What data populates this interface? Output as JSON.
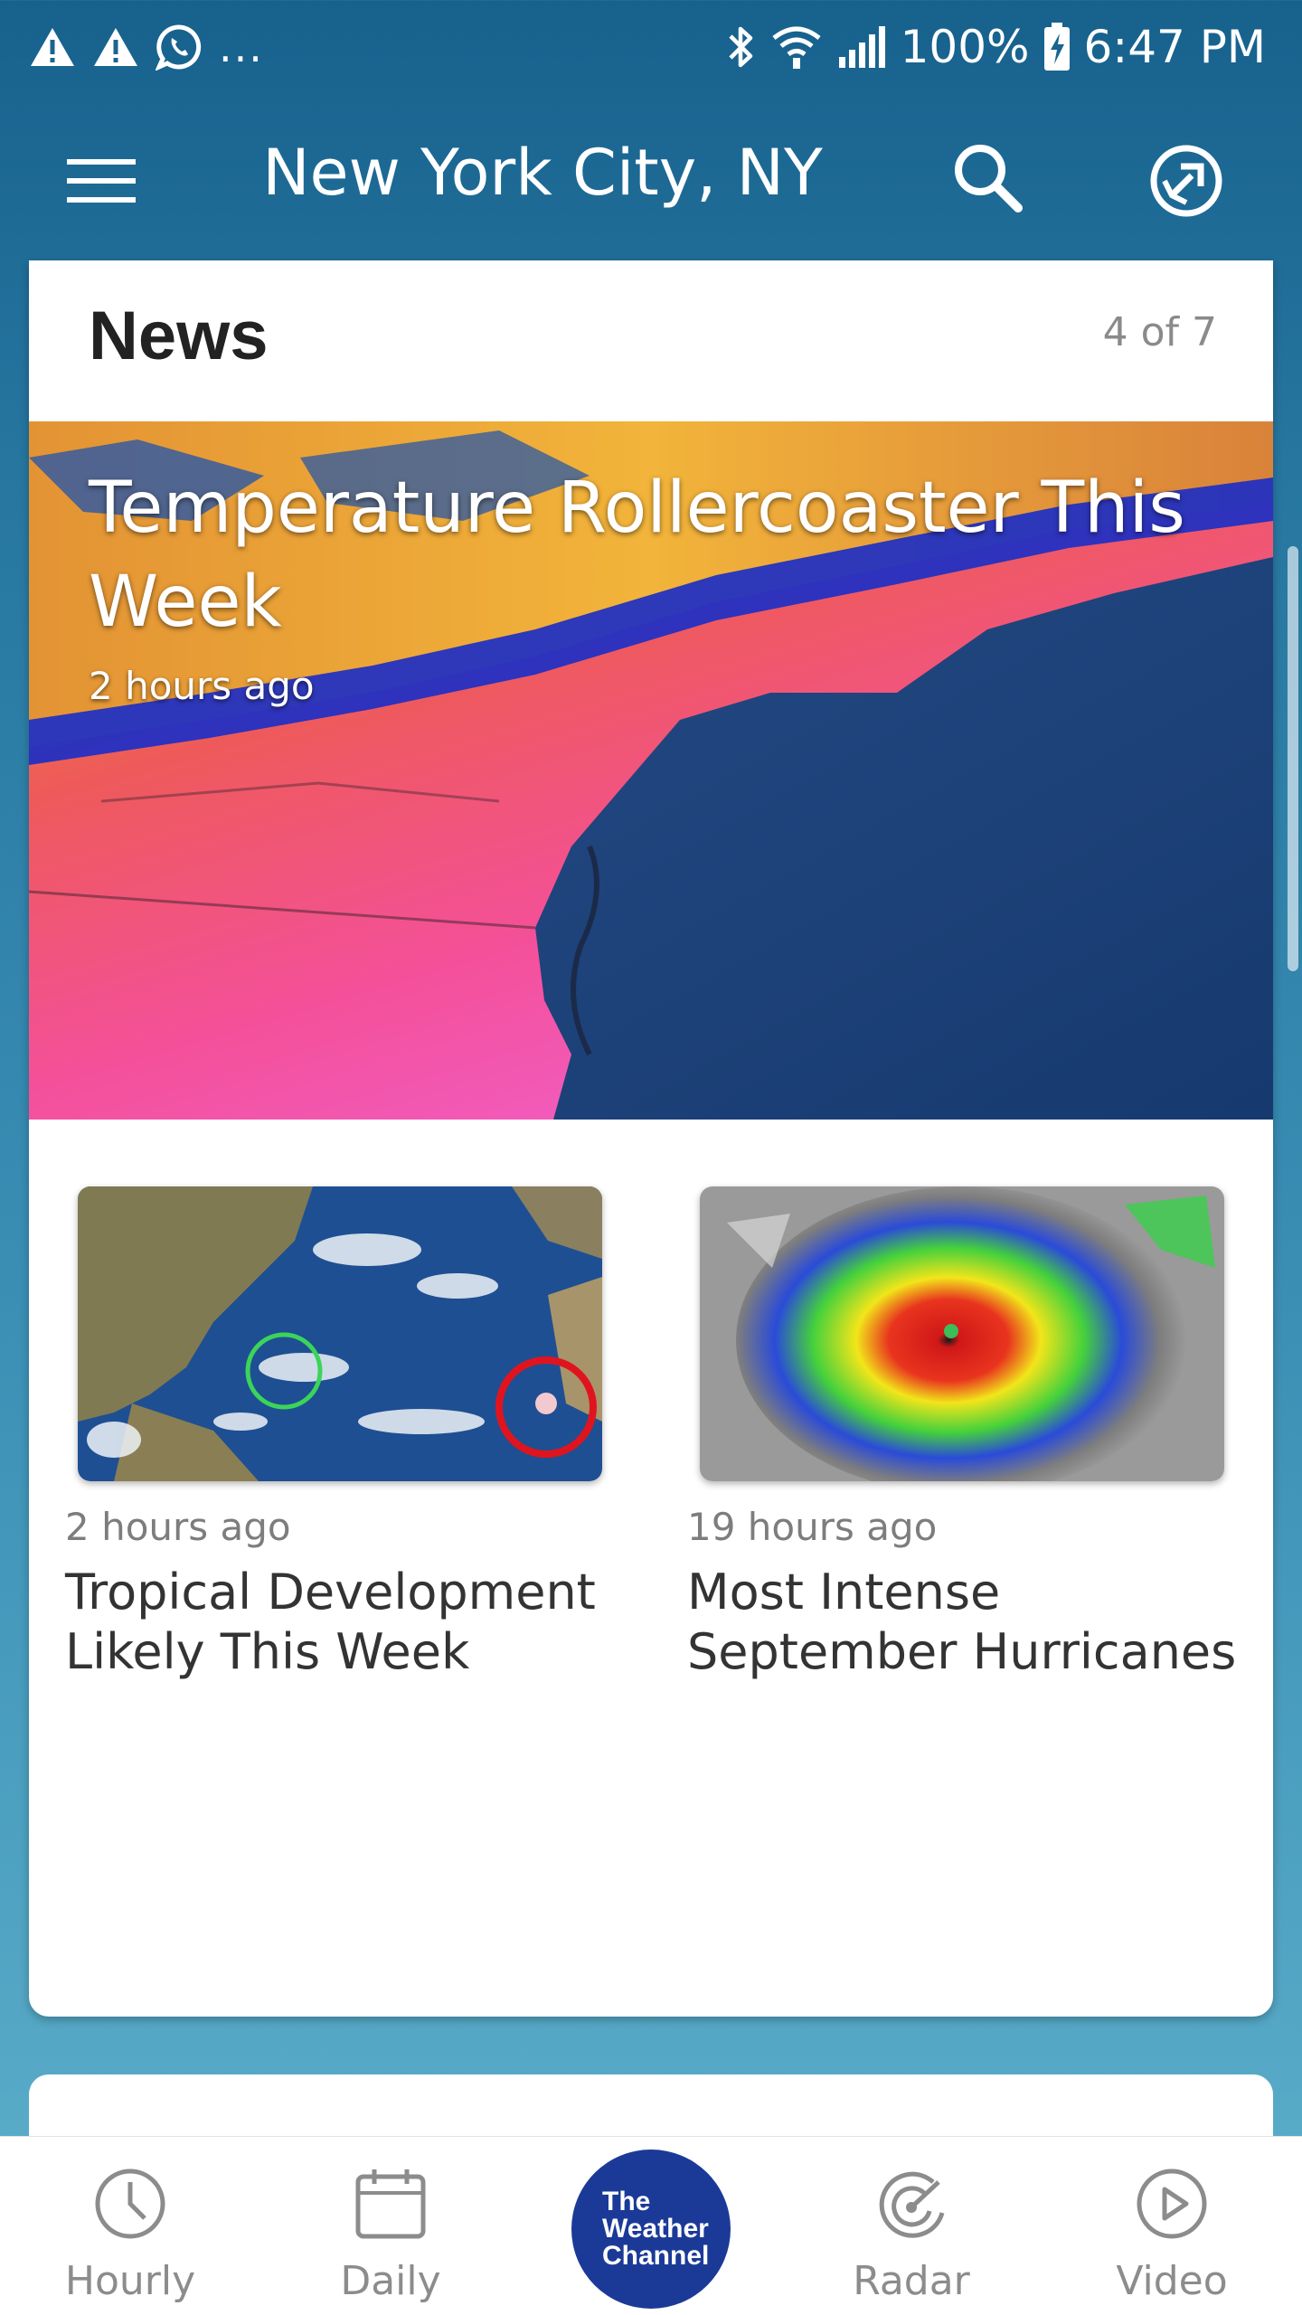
{
  "status_bar": {
    "battery": "100%",
    "time": "6:47 PM",
    "overflow": "...",
    "icons_left": [
      "warning-icon",
      "warning-icon",
      "whatsapp-icon"
    ],
    "icons_right": [
      "bluetooth-icon",
      "wifi-icon",
      "signal-icon",
      "battery-charging-icon"
    ]
  },
  "app_bar": {
    "location": "New York City, NY",
    "icons": [
      "menu-icon",
      "search-icon",
      "locate-icon"
    ]
  },
  "news": {
    "heading": "News",
    "counter": "4 of 7",
    "hero": {
      "title": "Temperature Rollercoaster This Week",
      "time": "2 hours ago"
    },
    "stories": [
      {
        "time": "2 hours ago",
        "title": "Tropical Development Likely This Week"
      },
      {
        "time": "19 hours ago",
        "title": "Most Intense September Hurricanes"
      }
    ]
  },
  "bottom_nav": {
    "items": [
      {
        "label": "Hourly",
        "icon": "clock-icon"
      },
      {
        "label": "Daily",
        "icon": "calendar-icon"
      },
      {
        "label": "Radar",
        "icon": "radar-icon"
      },
      {
        "label": "Video",
        "icon": "play-icon"
      }
    ],
    "logo_lines": [
      "The",
      "Weather",
      "Channel"
    ]
  },
  "colors": {
    "header_top": "#17618d",
    "background_bottom": "#5fb2cc",
    "logo_blue": "#1b3a98",
    "nav_gray": "#8c8c8c"
  }
}
